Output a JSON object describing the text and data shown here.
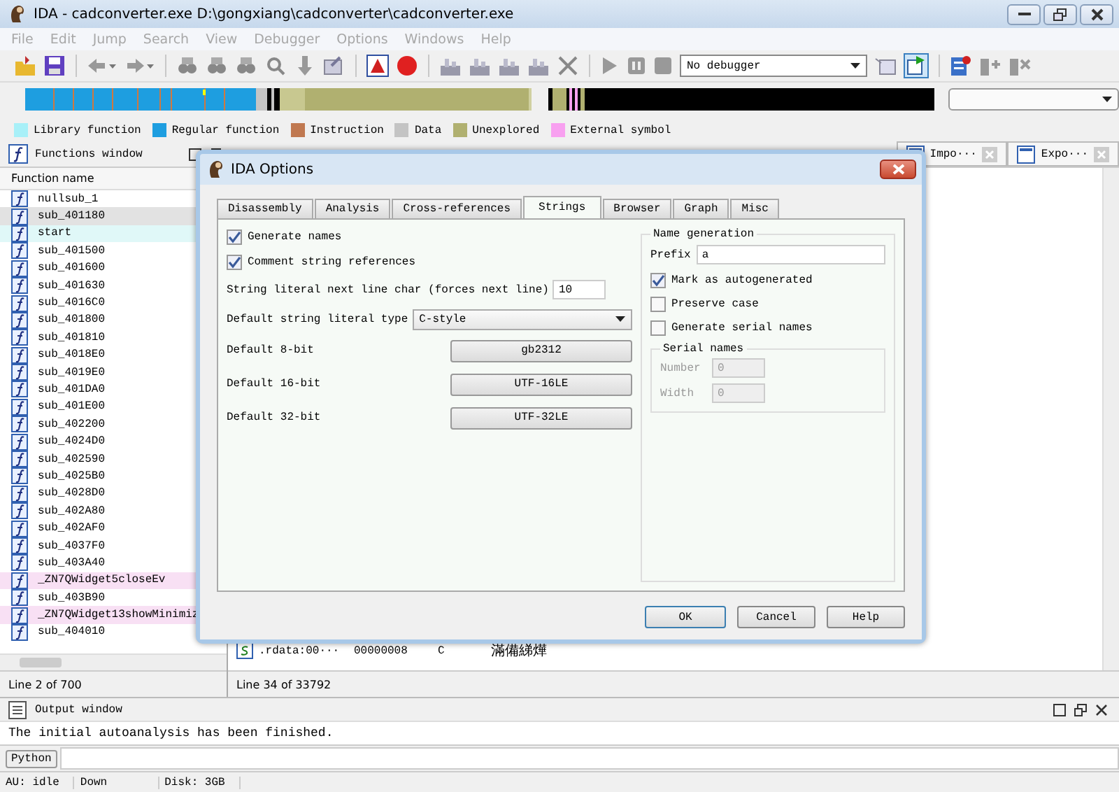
{
  "window": {
    "title": "IDA - cadconverter.exe D:\\gongxiang\\cadconverter\\cadconverter.exe"
  },
  "menu": {
    "disabled": true,
    "items": [
      "File",
      "Edit",
      "Jump",
      "Search",
      "View",
      "Debugger",
      "Options",
      "Windows",
      "Help"
    ]
  },
  "toolbar": {
    "debugger": "No debugger"
  },
  "legend": [
    {
      "label": "Library function",
      "color": "#a8f0f8"
    },
    {
      "label": "Regular function",
      "color": "#1e9ee0"
    },
    {
      "label": "Instruction",
      "color": "#c07850"
    },
    {
      "label": "Data",
      "color": "#c4c4c4"
    },
    {
      "label": "Unexplored",
      "color": "#b0b070"
    },
    {
      "label": "External symbol",
      "color": "#f8a0f0"
    }
  ],
  "functions_window": {
    "title": "Functions window",
    "column": "Function name",
    "status": "Line 2 of 700",
    "items": [
      {
        "name": "nullsub_1",
        "selected": false
      },
      {
        "name": "sub_401180",
        "selected": true
      },
      {
        "name": "start",
        "selected": false,
        "color": "#e0f8f8"
      },
      {
        "name": "sub_401500",
        "selected": false
      },
      {
        "name": "sub_401600",
        "selected": false
      },
      {
        "name": "sub_401630",
        "selected": false
      },
      {
        "name": "sub_4016C0",
        "selected": false
      },
      {
        "name": "sub_401800",
        "selected": false
      },
      {
        "name": "sub_401810",
        "selected": false
      },
      {
        "name": "sub_4018E0",
        "selected": false
      },
      {
        "name": "sub_4019E0",
        "selected": false
      },
      {
        "name": "sub_401DA0",
        "selected": false
      },
      {
        "name": "sub_401E00",
        "selected": false
      },
      {
        "name": "sub_402200",
        "selected": false
      },
      {
        "name": "sub_4024D0",
        "selected": false
      },
      {
        "name": "sub_402590",
        "selected": false
      },
      {
        "name": "sub_4025B0",
        "selected": false
      },
      {
        "name": "sub_4028D0",
        "selected": false
      },
      {
        "name": "sub_402A80",
        "selected": false
      },
      {
        "name": "sub_402AF0",
        "selected": false
      },
      {
        "name": "sub_4037F0",
        "selected": false
      },
      {
        "name": "sub_403A40",
        "selected": false
      },
      {
        "name": "_ZN7QWidget5closeEv",
        "selected": false,
        "color": "#f8e0f4"
      },
      {
        "name": "sub_403B90",
        "selected": false
      },
      {
        "name": "_ZN7QWidget13showMinimiz",
        "selected": false,
        "color": "#f8e0f4"
      },
      {
        "name": "sub_404010",
        "selected": false
      }
    ]
  },
  "tabs": [
    {
      "label": "Impo···"
    },
    {
      "label": "Expo···"
    }
  ],
  "strings_view": {
    "status": "Line 34 of 33792",
    "rows": [
      {
        "address": ".rdata:00···",
        "length": "00000008",
        "type": "C",
        "string": "滿備綈燁"
      }
    ]
  },
  "dialog": {
    "title": "IDA Options",
    "tabs": [
      {
        "label": "Disassembly",
        "selected": false
      },
      {
        "label": "Analysis",
        "selected": false
      },
      {
        "label": "Cross-references",
        "selected": false
      },
      {
        "label": "Strings",
        "selected": true
      },
      {
        "label": "Browser",
        "selected": false
      },
      {
        "label": "Graph",
        "selected": false
      },
      {
        "label": "Misc",
        "selected": false
      }
    ],
    "options": [
      {
        "label": "Generate names",
        "checked": true
      },
      {
        "label": "Comment string references",
        "checked": true
      }
    ],
    "next_line_char": {
      "label": "String literal next line char (forces next line)",
      "value": "10"
    },
    "literal_type": {
      "label": "Default string literal type",
      "value": "C-style"
    },
    "encodings": [
      {
        "label": "Default 8-bit",
        "value": "gb2312"
      },
      {
        "label": "Default 16-bit",
        "value": "UTF-16LE"
      },
      {
        "label": "Default 32-bit",
        "value": "UTF-32LE"
      }
    ],
    "name_generation": {
      "title": "Name generation",
      "prefix_label": "Prefix",
      "prefix": "a",
      "options": [
        {
          "label": "Mark as autogenerated",
          "checked": true
        },
        {
          "label": "Preserve case",
          "checked": false
        },
        {
          "label": "Generate serial names",
          "checked": false
        }
      ],
      "serial": {
        "title": "Serial names",
        "disabled": true,
        "fields": [
          {
            "label": "Number",
            "value": "0"
          },
          {
            "label": "Width",
            "value": "0"
          }
        ]
      }
    },
    "buttons": [
      "OK",
      "Cancel",
      "Help"
    ]
  },
  "output_window": {
    "title": "Output window",
    "text": "The initial autoanalysis has been finished.",
    "button": "Python"
  },
  "status_bar": [
    "AU:  idle",
    "Down",
    "Disk: 3GB"
  ]
}
